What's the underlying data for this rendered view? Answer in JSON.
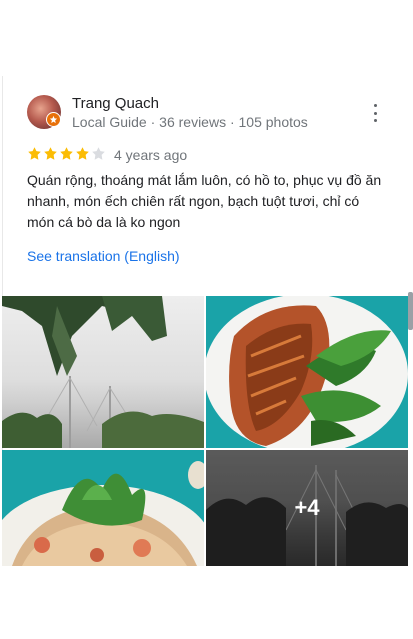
{
  "review": {
    "author_name": "Trang Quach",
    "author_meta": "Local Guide · 36 reviews · 105 photos",
    "rating": 4,
    "rating_max": 5,
    "time_ago": "4 years ago",
    "text": "Quán rộng, thoáng mát lắm luôn, có hồ to, phục vụ đồ ăn nhanh, món ếch chiên rất ngon, bạch tuột tươi, chỉ có món cá bò da là ko ngon",
    "translate_link": "See translation (English)",
    "more_photos_label": "+4"
  },
  "colors": {
    "star_filled": "#fbbc04",
    "star_empty": "#dadce0",
    "link": "#1a73e8",
    "badge": "#e8710a"
  },
  "icons": {
    "more": "more-vert-icon",
    "badge": "local-guide-badge-icon",
    "star": "star-icon"
  }
}
